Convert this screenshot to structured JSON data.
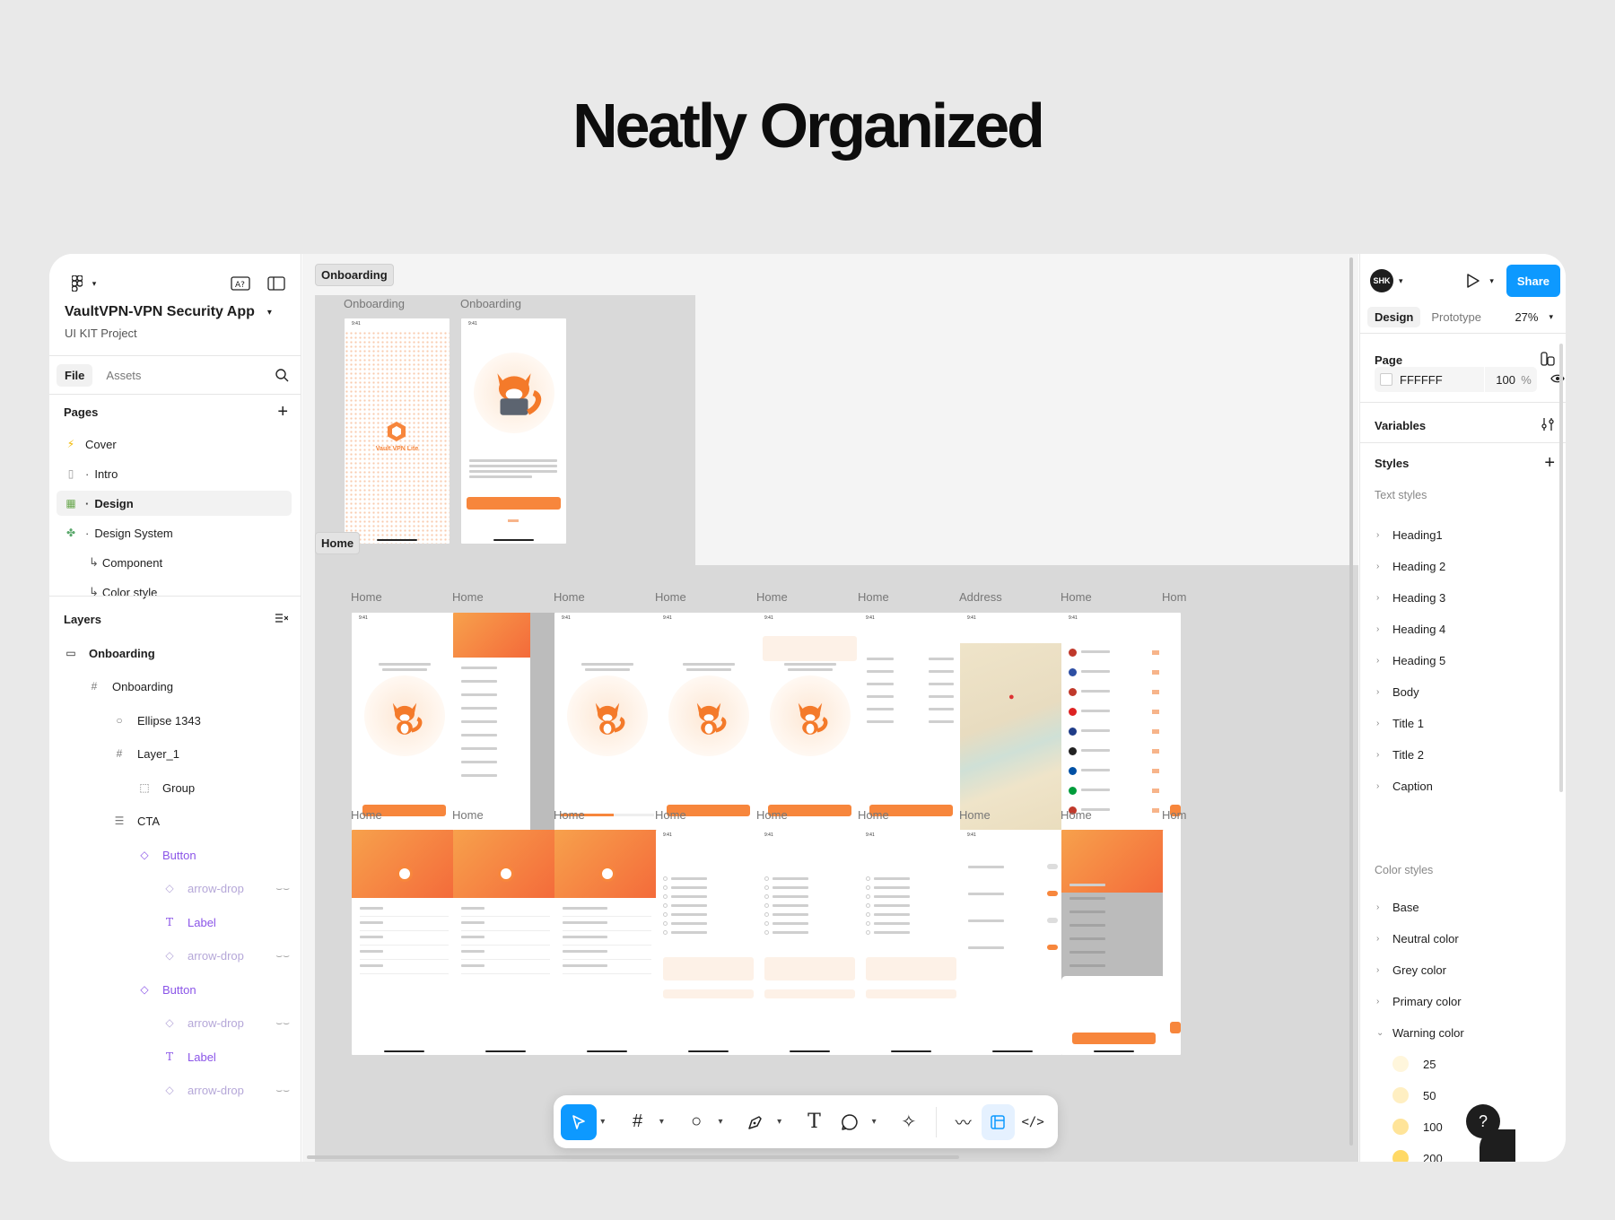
{
  "headline": "Neatly Organized",
  "left_panel": {
    "project_title": "VaultVPN-VPN Security App",
    "project_subtitle": "UI KIT Project",
    "tabs": {
      "file": "File",
      "assets": "Assets"
    },
    "pages_label": "Pages",
    "pages": [
      {
        "label": "Cover",
        "icon": "⚡"
      },
      {
        "label": "Intro",
        "icon": "▯"
      },
      {
        "label": "Design",
        "icon": "▦"
      },
      {
        "label": "Design System",
        "icon": "✤"
      },
      {
        "label": "Component",
        "icon": "↳"
      },
      {
        "label": "Color style",
        "icon": "↳"
      }
    ],
    "layers_label": "Layers",
    "layers": [
      {
        "label": "Onboarding"
      },
      {
        "label": "Onboarding"
      },
      {
        "label": "Ellipse 1343"
      },
      {
        "label": "Layer_1"
      },
      {
        "label": "Group"
      },
      {
        "label": "CTA"
      },
      {
        "label": "Button"
      },
      {
        "label": "arrow-drop"
      },
      {
        "label": "Label"
      },
      {
        "label": "arrow-drop"
      },
      {
        "label": "Button"
      },
      {
        "label": "arrow-drop"
      },
      {
        "label": "Label"
      },
      {
        "label": "arrow-drop"
      }
    ]
  },
  "canvas": {
    "sections": {
      "onboarding": "Onboarding",
      "home": "Home"
    },
    "onboarding_labels": [
      "Onboarding",
      "Onboarding"
    ],
    "row1_labels": [
      "Home",
      "Home",
      "Home",
      "Home",
      "Home",
      "Home",
      "Address",
      "Home",
      "Hom"
    ],
    "row2_labels": [
      "Home",
      "Home",
      "Home",
      "Home",
      "Home",
      "Home",
      "Home",
      "Home",
      "Hom"
    ],
    "brand": "Vault VPN Lite",
    "status_time": "9:41"
  },
  "right_panel": {
    "avatar_initials": "SHK",
    "share_label": "Share",
    "tabs": {
      "design": "Design",
      "prototype": "Prototype"
    },
    "zoom": "27%",
    "page_label": "Page",
    "page_color": "FFFFFF",
    "page_opacity": "100",
    "percent": "%",
    "variables_label": "Variables",
    "styles_label": "Styles",
    "text_styles_label": "Text styles",
    "text_styles": [
      "Heading1",
      "Heading 2",
      "Heading 3",
      "Heading 4",
      "Heading 5",
      "Body",
      "Title 1",
      "Title 2",
      "Caption"
    ],
    "color_styles_label": "Color styles",
    "color_styles": [
      "Base",
      "Neutral color",
      "Grey color",
      "Primary color",
      "Warning color"
    ],
    "warning_swatches": [
      {
        "label": "25",
        "color": "#FFF6DC"
      },
      {
        "label": "50",
        "color": "#FFEFC2"
      },
      {
        "label": "100",
        "color": "#FFE499"
      },
      {
        "label": "200",
        "color": "#FFD966"
      }
    ]
  },
  "colors": {
    "accent": "#0D99FF",
    "brand_orange": "#F7863C",
    "layer_component": "#8B55E8"
  }
}
